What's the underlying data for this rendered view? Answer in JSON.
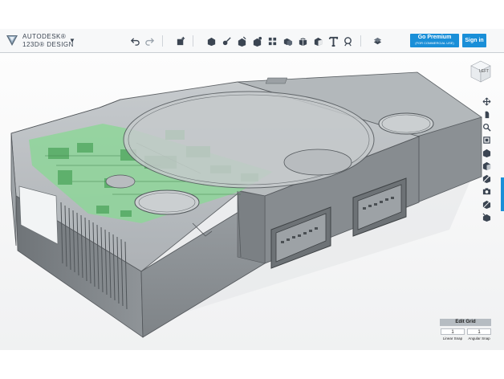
{
  "app": {
    "brand_line1": "AUTODESK®",
    "brand_line2": "123D® DESIGN"
  },
  "toolbar": {
    "icons": [
      "undo-icon",
      "redo-icon",
      "new-primitive-icon",
      "sketch-icon",
      "construct-icon",
      "modify-icon",
      "pattern-icon",
      "group-icon",
      "combine-icon",
      "measure-icon",
      "text-icon",
      "snap-icon",
      "material-icon"
    ],
    "premium_label": "Go Premium",
    "premium_sub": "(FOR COMMERCIAL USE)",
    "signin_label": "Sign in"
  },
  "viewcube": {
    "face_label": "LEFT"
  },
  "right_tools": [
    "pan-icon",
    "orbit-icon",
    "zoom-icon",
    "fit-icon",
    "view-mode-icon",
    "materials-icon",
    "hide-icon",
    "camera-icon",
    "visibility-icon",
    "settings-icon"
  ],
  "edit_grid": {
    "title": "Edit Grid",
    "linear_value": "1",
    "angular_value": "1",
    "linear_label": "Linear Snap",
    "angular_label": "Angular Snap"
  },
  "colors": {
    "accent": "#1a8fd8",
    "model_gray": "#8d9296",
    "pcb_green": "#6fcf7e"
  }
}
